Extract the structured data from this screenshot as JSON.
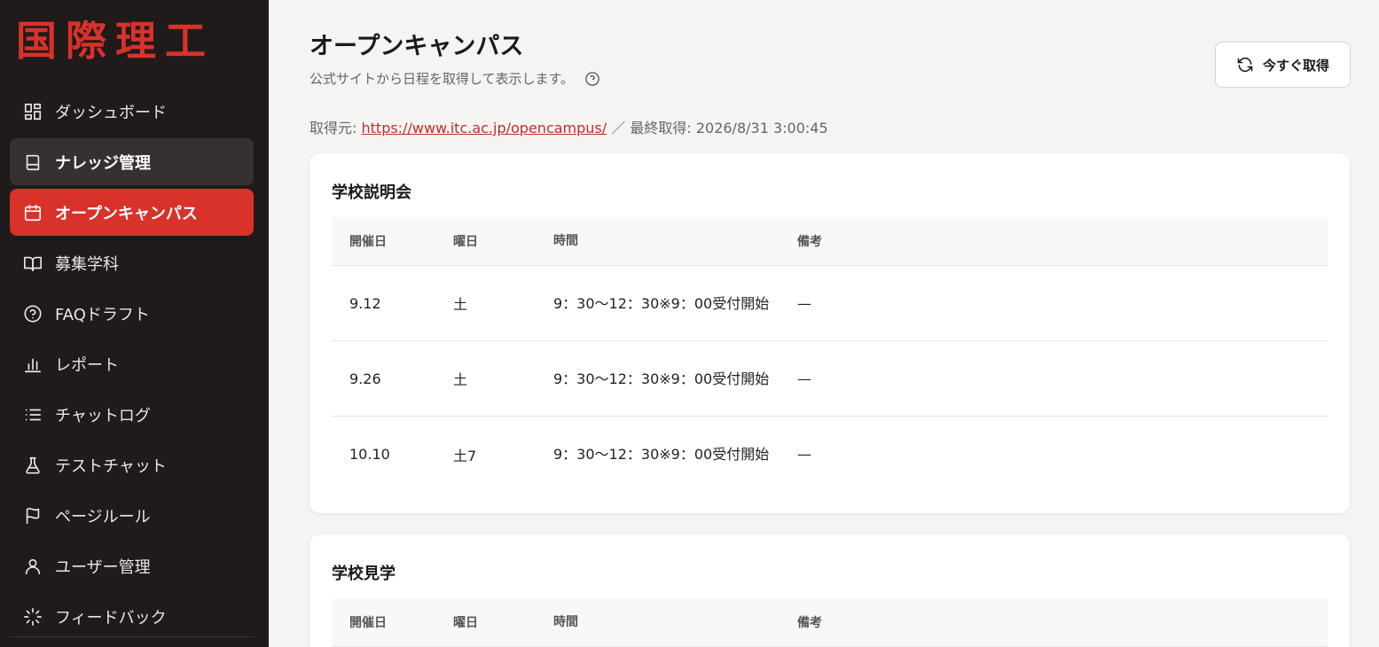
{
  "brand": {
    "logo": "国際理工",
    "accent": "#d8322b"
  },
  "sidebar": {
    "items": [
      {
        "label": "ダッシュボード",
        "icon": "dashboard-icon"
      },
      {
        "label": "ナレッジ管理",
        "icon": "book-icon"
      },
      {
        "label": "オープンキャンパス",
        "icon": "calendar-icon"
      },
      {
        "label": "募集学科",
        "icon": "open-book-icon"
      },
      {
        "label": "FAQドラフト",
        "icon": "help-circle-icon"
      },
      {
        "label": "レポート",
        "icon": "bar-chart-icon"
      },
      {
        "label": "チャットログ",
        "icon": "list-icon"
      },
      {
        "label": "テストチャット",
        "icon": "flask-icon"
      },
      {
        "label": "ページルール",
        "icon": "flag-icon"
      },
      {
        "label": "ユーザー管理",
        "icon": "user-icon"
      },
      {
        "label": "フィードバック",
        "icon": "loader-icon"
      }
    ]
  },
  "header": {
    "title": "オープンキャンパス",
    "subtitle": "公式サイトから日程を取得して表示します。",
    "refresh_label": "今すぐ取得"
  },
  "source": {
    "prefix": "取得元:",
    "url": "https://www.itc.ac.jp/opencampus/",
    "separator": "／",
    "last_fetched": "最終取得: 2026/8/31 3:00:45"
  },
  "sections": [
    {
      "title": "学校説明会",
      "columns": [
        "開催日",
        "曜日",
        "時間",
        "備考"
      ],
      "rows": [
        {
          "date": "9.12",
          "weekday": "土",
          "time": "9：30〜12：30※9：00受付開始",
          "note": "—"
        },
        {
          "date": "9.26",
          "weekday": "土",
          "time": "9：30〜12：30※9：00受付開始",
          "note": "—"
        },
        {
          "date": "10.10",
          "weekday": "土7",
          "time": "9：30〜12：30※9：00受付開始",
          "note": "—"
        }
      ]
    },
    {
      "title": "学校見学",
      "columns": [
        "開催日",
        "曜日",
        "時間",
        "備考"
      ],
      "rows": []
    }
  ]
}
